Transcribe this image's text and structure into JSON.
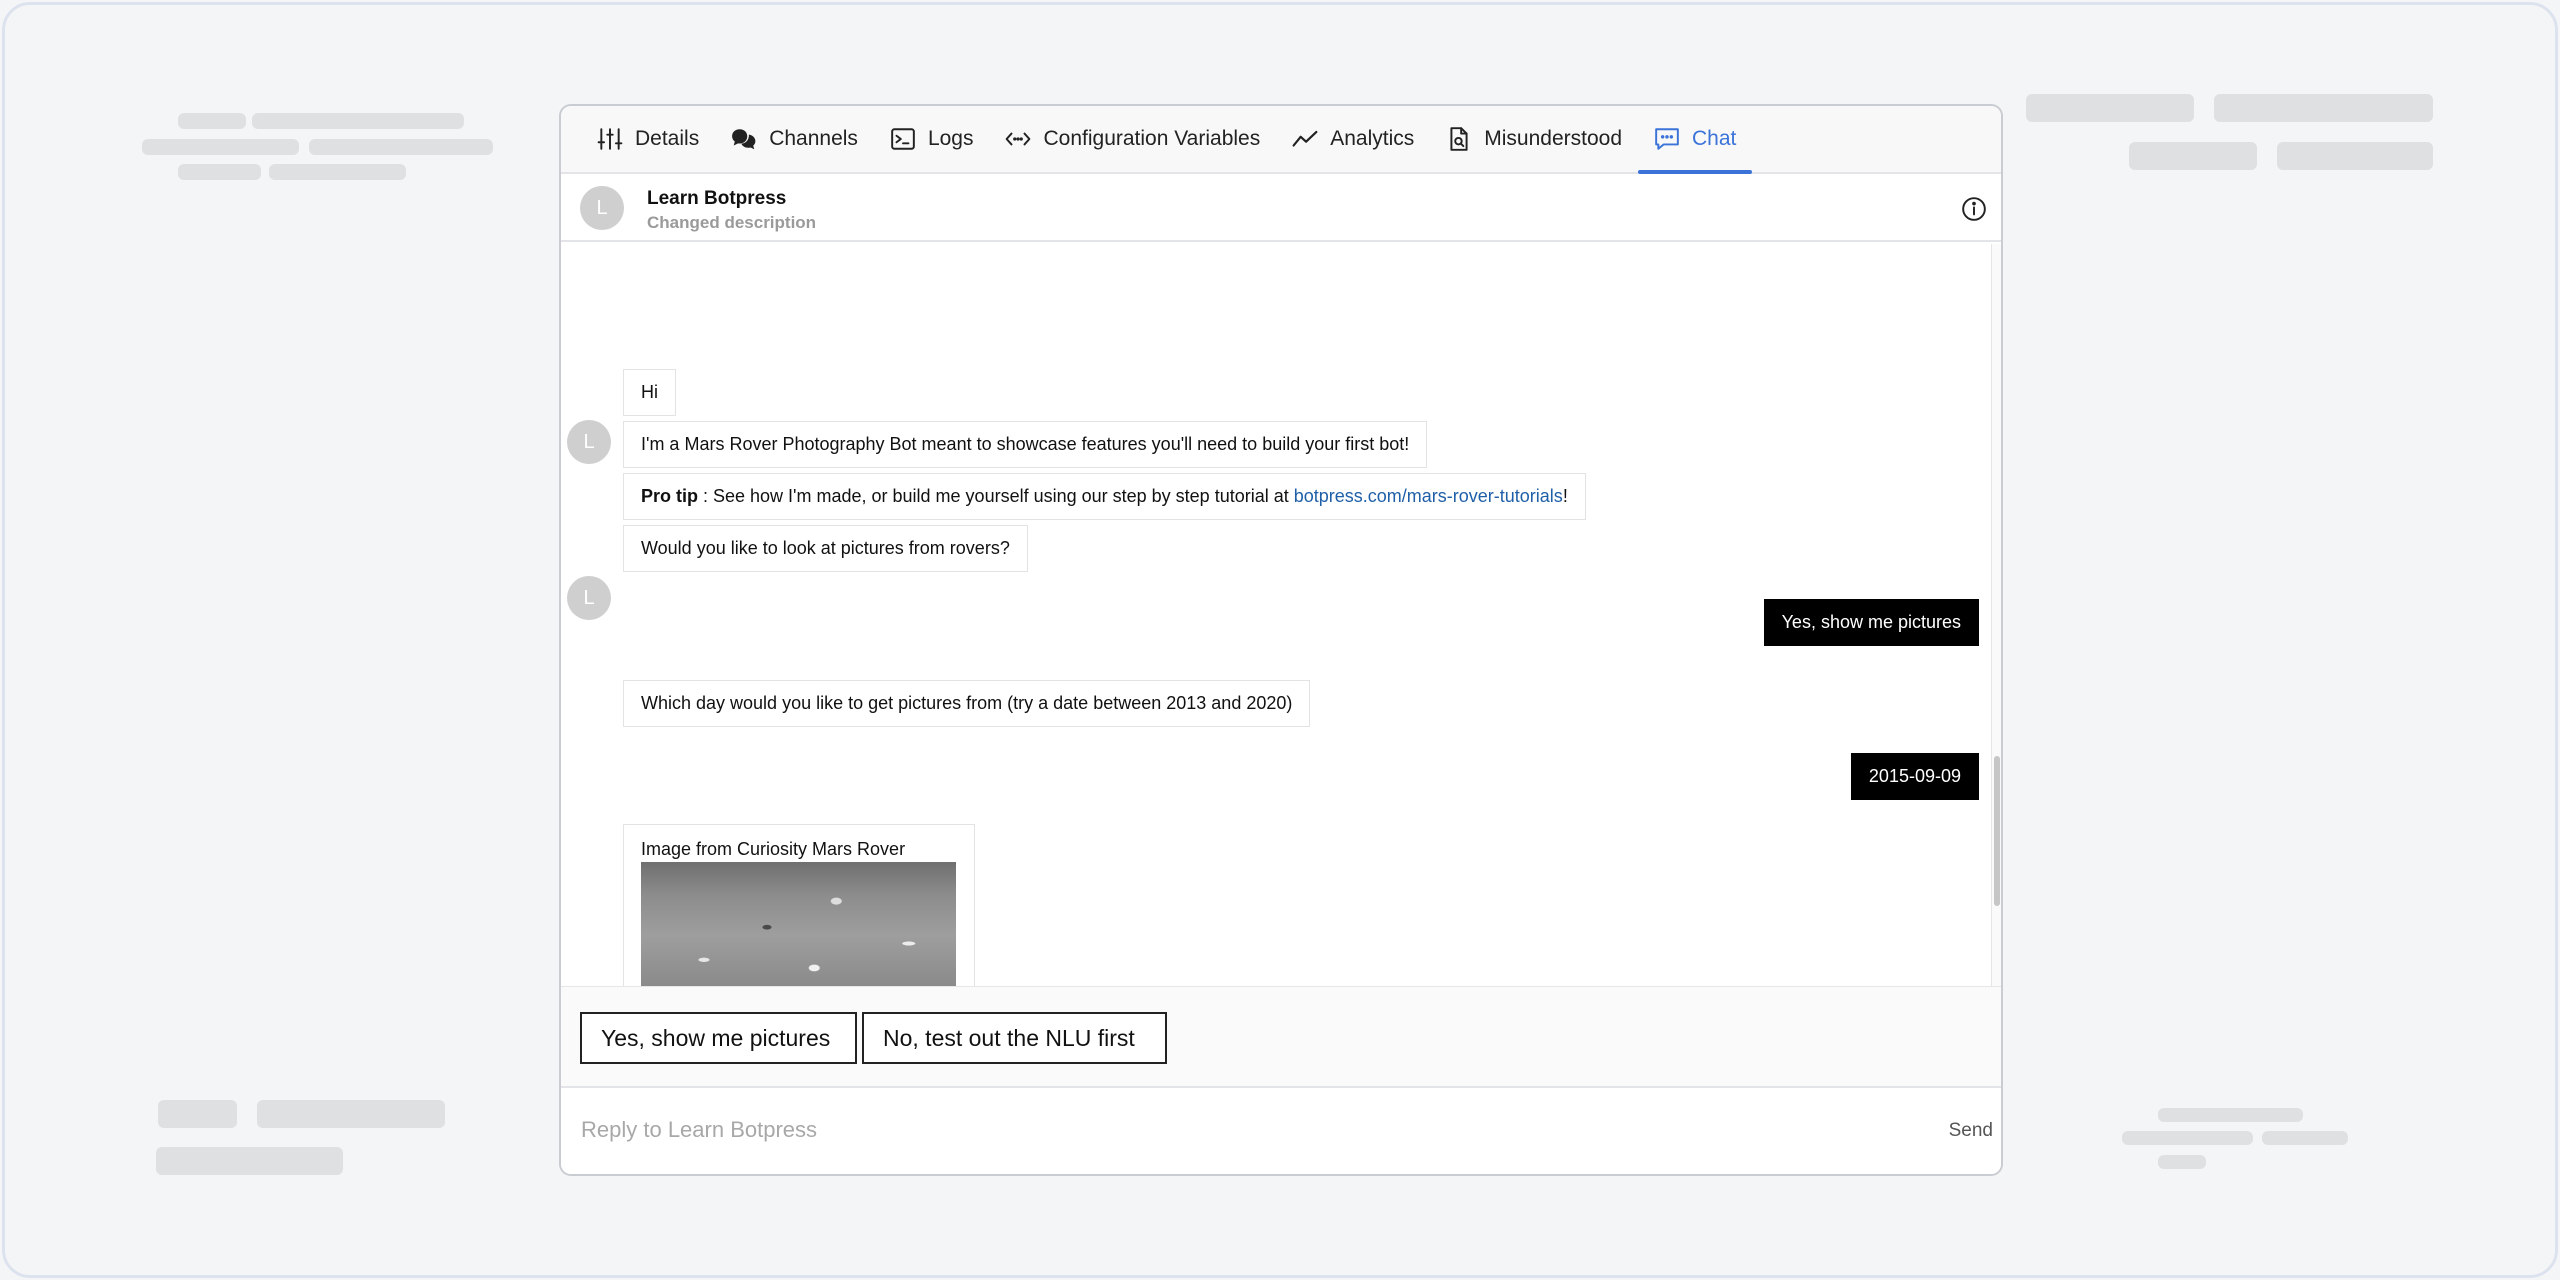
{
  "tabs": [
    {
      "label": "Details",
      "icon": "sliders-icon"
    },
    {
      "label": "Channels",
      "icon": "channels-icon"
    },
    {
      "label": "Logs",
      "icon": "terminal-icon"
    },
    {
      "label": "Configuration Variables",
      "icon": "code-icon"
    },
    {
      "label": "Analytics",
      "icon": "chart-line-icon"
    },
    {
      "label": "Misunderstood",
      "icon": "document-search-icon"
    },
    {
      "label": "Chat",
      "icon": "chat-icon",
      "active": true
    }
  ],
  "accent_color": "#3b73d9",
  "bot": {
    "avatar_letter": "L",
    "name": "Learn Botpress",
    "description": "Changed description"
  },
  "messages": {
    "m1": "Hi",
    "m2": "I'm a Mars Rover Photography Bot meant to showcase features you'll need to build your first bot!",
    "m3": {
      "bold": "Pro tip",
      "text": " : See how I'm made, or build me yourself using our step by step tutorial at ",
      "link": "botpress.com/mars-rover-tutorials",
      "end": "!"
    },
    "m4": "Would you like to look at pictures from rovers?",
    "u1": "Yes, show me pictures",
    "m5": "Which day would you like to get pictures from (try a date between 2013 and 2020)",
    "u2": "2015-09-09",
    "card_title": "Image from Curiosity Mars Rover"
  },
  "quick_replies": [
    "Yes, show me pictures",
    "No, test out the NLU first"
  ],
  "composer": {
    "placeholder": "Reply to Learn Botpress",
    "send_label": "Send"
  }
}
